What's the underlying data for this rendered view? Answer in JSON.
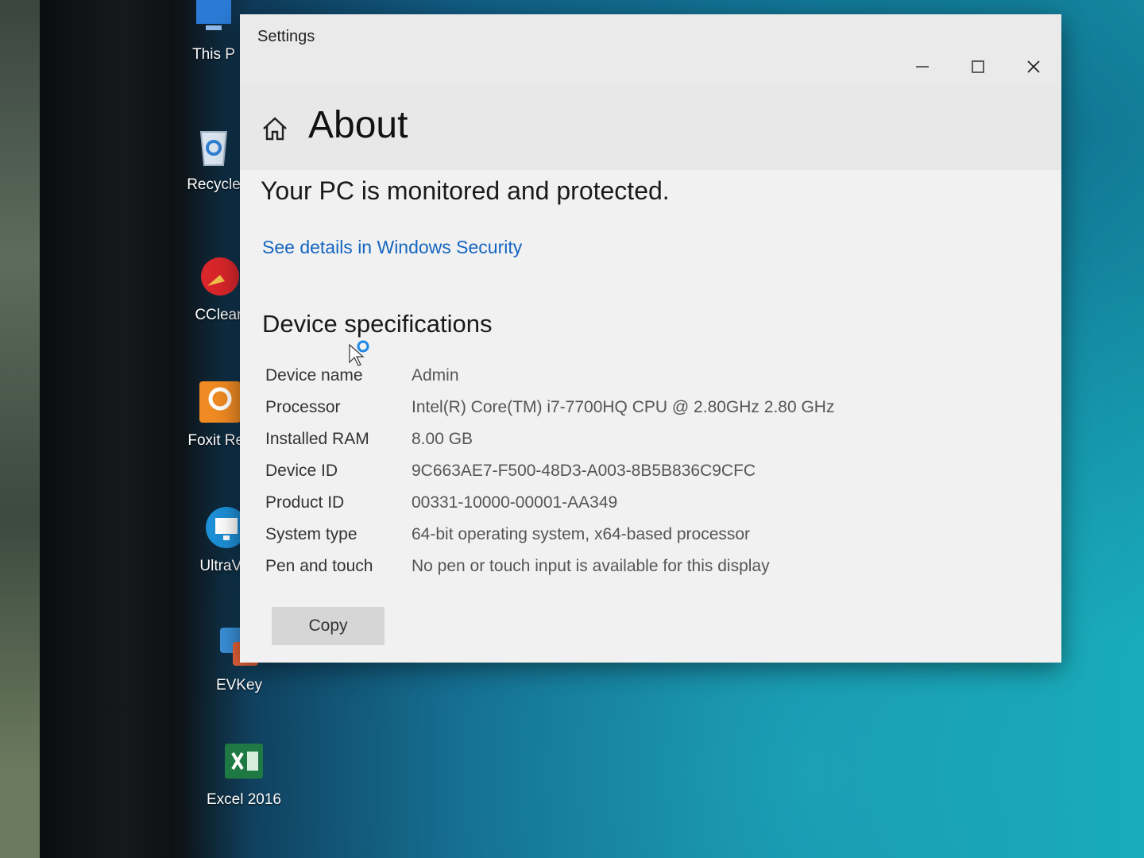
{
  "desktop": {
    "icons": [
      {
        "label": "This P",
        "icon": "this-pc-icon"
      },
      {
        "label": "Recycle",
        "icon": "recycle-bin-icon"
      },
      {
        "label": "CClean",
        "icon": "ccleaner-icon"
      },
      {
        "label": "Foxit Rea",
        "icon": "foxit-reader-icon"
      },
      {
        "label": "UltraVie",
        "icon": "ultraviewer-icon"
      },
      {
        "label": "EVKey",
        "icon": "evkey-icon"
      },
      {
        "label": "Excel 2016",
        "icon": "excel-icon"
      }
    ]
  },
  "window": {
    "app_title": "Settings",
    "controls": {
      "minimize": "minimize-icon",
      "maximize": "maximize-icon",
      "close": "close-icon"
    }
  },
  "page": {
    "title": "About",
    "status": "Your PC is monitored and protected.",
    "security_link": "See details in Windows Security",
    "section_title": "Device specifications",
    "specs": [
      {
        "label": "Device name",
        "value": "Admin"
      },
      {
        "label": "Processor",
        "value": "Intel(R) Core(TM) i7-7700HQ CPU @ 2.80GHz   2.80 GHz"
      },
      {
        "label": "Installed RAM",
        "value": "8.00 GB"
      },
      {
        "label": "Device ID",
        "value": "9C663AE7-F500-48D3-A003-8B5B836C9CFC"
      },
      {
        "label": "Product ID",
        "value": "00331-10000-00001-AA349"
      },
      {
        "label": "System type",
        "value": "64-bit operating system, x64-based processor"
      },
      {
        "label": "Pen and touch",
        "value": "No pen or touch input is available for this display"
      }
    ],
    "copy_button": "Copy"
  },
  "colors": {
    "link": "#1565c0",
    "window_bg": "#f1f1f1",
    "desktop_teal": "#148aa6"
  }
}
